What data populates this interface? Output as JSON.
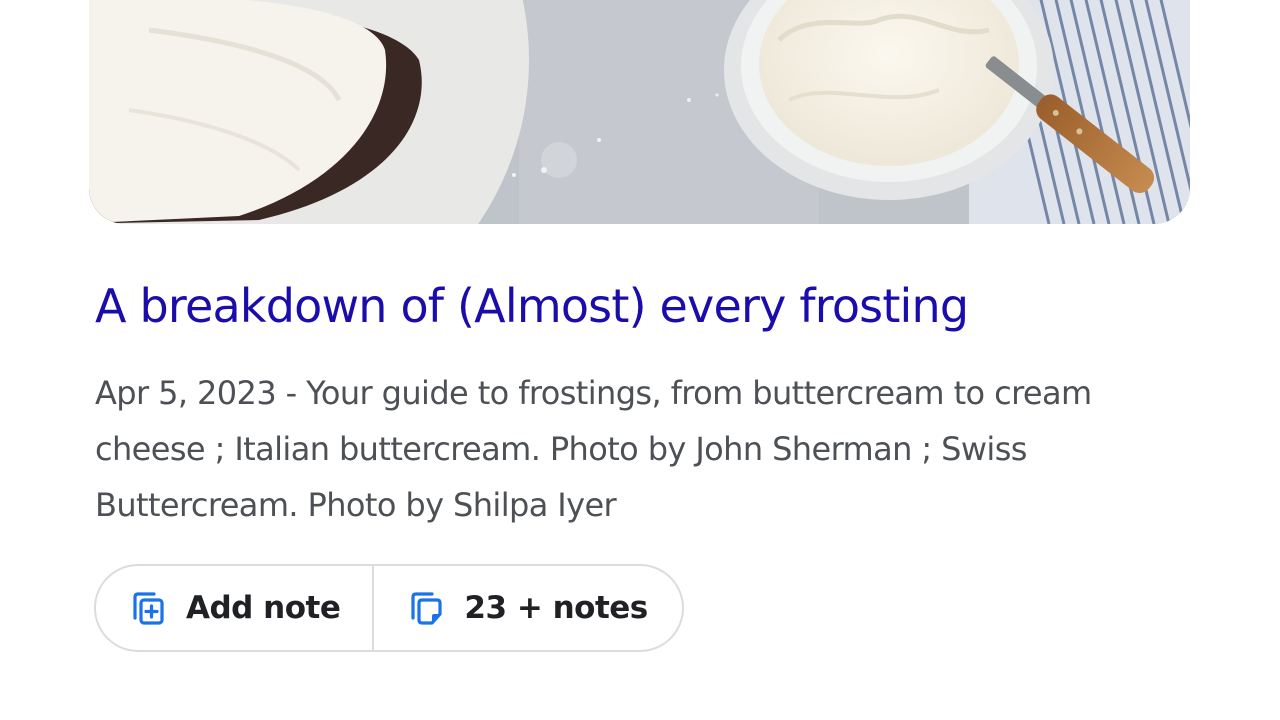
{
  "result": {
    "title": "A breakdown of (Almost) every frosting",
    "snippet": "Apr 5, 2023 - Your guide to frostings, from buttercream to cream cheese ; Italian buttercream. Photo by John Sherman ; Swiss Buttercream. Photo by Shilpa Iyer"
  },
  "actions": {
    "add_note": {
      "label": "Add note",
      "icon": "add-note-icon"
    },
    "notes": {
      "label": "23 + notes",
      "icon": "notes-icon"
    }
  },
  "colors": {
    "title_link": "#1a0dab",
    "snippet_text": "#4d5156",
    "icon_blue": "#1a73e8",
    "pill_border": "#dadce0"
  }
}
